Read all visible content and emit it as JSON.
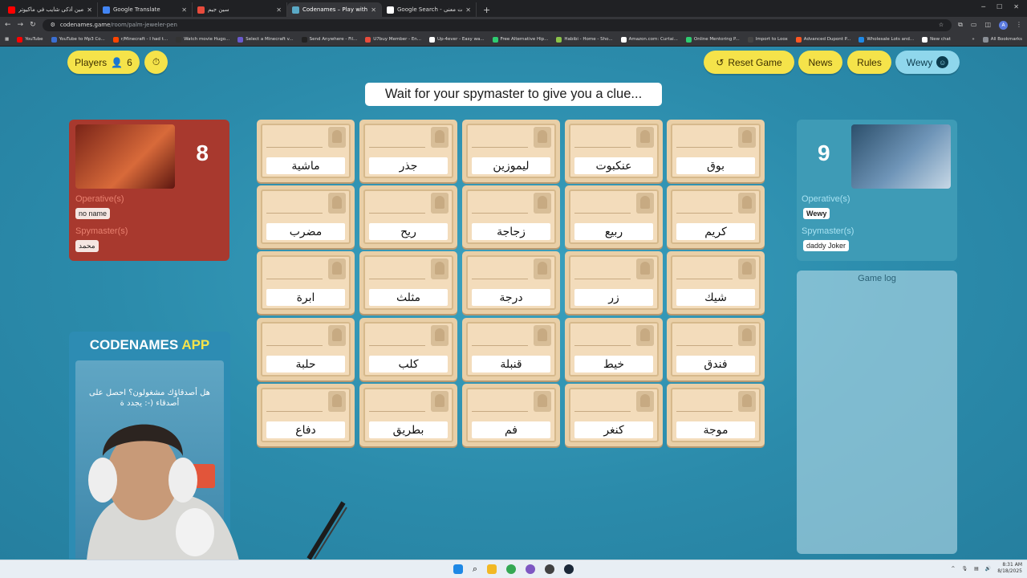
{
  "browser": {
    "tabs": [
      {
        "title": "مين أذكى شايب في ماكيوتر | ...",
        "color": "#ff0000",
        "active": false
      },
      {
        "title": "Google Translate",
        "color": "#4285f4",
        "active": false
      },
      {
        "title": "سين جيم",
        "color": "#e84b3c",
        "active": false
      },
      {
        "title": "Codenames – Play with your F...",
        "color": "#5aa9c6",
        "active": true
      },
      {
        "title": "Google Search - حقيت معنى",
        "color": "#ffffff",
        "active": false
      }
    ],
    "new_tab": "+",
    "url_host": "codenames.game",
    "url_path": "/room/palm-jeweler-pen",
    "bookmarks": [
      {
        "label": "YouTube",
        "color": "#ff0000"
      },
      {
        "label": "YouTube to Mp3 Co...",
        "color": "#3b6fd1"
      },
      {
        "label": "r/Minecraft - I had t...",
        "color": "#ff4500"
      },
      {
        "label": "Watch movie Hugo...",
        "color": "#333333"
      },
      {
        "label": "Select a Minecraft v...",
        "color": "#6a5acd"
      },
      {
        "label": "Send Anywhere - Fil...",
        "color": "#222222"
      },
      {
        "label": "U7buy Member - En...",
        "color": "#e74c3c"
      },
      {
        "label": "Up-4ever - Easy wa...",
        "color": "#ffffff"
      },
      {
        "label": "Free Alternative Hip...",
        "color": "#2ecc71"
      },
      {
        "label": "Habibi - Home - Sho...",
        "color": "#8bc34a"
      },
      {
        "label": "Amazon.com: Curtai...",
        "color": "#ffffff"
      },
      {
        "label": "Online Mentoring P...",
        "color": "#2ecc71"
      },
      {
        "label": "Import to Loox",
        "color": "#444444"
      },
      {
        "label": "Advanced Dupont P...",
        "color": "#ff5722"
      },
      {
        "label": "Wholesale Lots and...",
        "color": "#1e88e5"
      },
      {
        "label": "New chat",
        "color": "#ffffff"
      }
    ],
    "all_bookmarks": "All Bookmarks"
  },
  "game": {
    "players_label": "Players",
    "players_count": "6",
    "reset_label": "Reset Game",
    "news_label": "News",
    "rules_label": "Rules",
    "user_label": "Wewy",
    "clue_text": "Wait for your spymaster to give you a clue...",
    "red_team": {
      "remaining": "8",
      "operatives_label": "Operative(s)",
      "operative": "no name",
      "spymasters_label": "Spymaster(s)",
      "spymaster": "محمد"
    },
    "blue_team": {
      "remaining": "9",
      "operatives_label": "Operative(s)",
      "operative": "Wewy",
      "spymasters_label": "Spymaster(s)",
      "spymaster": "daddy Joker"
    },
    "cards": [
      [
        "ماشية",
        "جذر",
        "ليموزين",
        "عنكبوت",
        "بوق"
      ],
      [
        "مضرب",
        "ريح",
        "زجاجة",
        "ربيع",
        "كريم"
      ],
      [
        "ابرة",
        "مثلث",
        "درجة",
        "زر",
        "شيك"
      ],
      [
        "حلبة",
        "كلب",
        "قنبلة",
        "خيط",
        "فندق"
      ],
      [
        "دفاع",
        "بطريق",
        "فم",
        "كنغر",
        "موجة"
      ]
    ],
    "game_log_label": "Game log",
    "promo": {
      "title_main": "CODENAMES",
      "title_app": "APP",
      "text": "هل أصدقاؤك مشغولون؟ احصل على أصدقاء (-: يجدد ة"
    }
  },
  "taskbar": {
    "time": "8:31 AM",
    "date": "8/18/2025"
  }
}
